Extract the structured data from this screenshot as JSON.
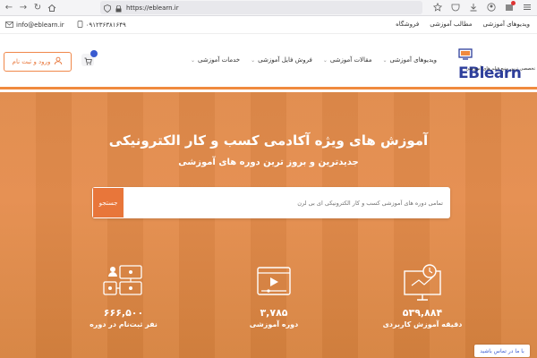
{
  "browser": {
    "url": "https://eblearn.ir",
    "accent": "#e8763a"
  },
  "topbar": {
    "email": "info@eblearn.ir",
    "phone": "۰۹۱۲۳۶۳۸۱۶۴۹",
    "links": [
      "ویدیوهای آموزشی",
      "مطالب آموزشی",
      "فروشگاه"
    ]
  },
  "header": {
    "login_label": "ورود و ثبت نام",
    "logo_text_main": "EBlearn",
    "logo_text_sub": "تخصصی ترین منبع فیلم های آموزشی",
    "menu": [
      "ویدیوهای آموزشی",
      "مقالات آموزشی",
      "فروش فایل آموزشی",
      "خدمات آموزشی"
    ]
  },
  "hero": {
    "title": "آموزش های ویژه آکادمی کسب و کار الکترونیکی",
    "subtitle": "جدیدترین و بروز ترین دوره های آموزشی",
    "search_placeholder": "تمامی دوره های آموزشی کسب و کار الکترونیکی ای بی لرن",
    "search_button": "جستجو"
  },
  "stats": [
    {
      "number": "۵۳۹,۸۸۴",
      "label": "دقیقه آموزش کاربردی",
      "icon": "clock-monitor-icon"
    },
    {
      "number": "۳,۷۸۵",
      "label": "دوره آموزشی",
      "icon": "video-player-icon"
    },
    {
      "number": "۶۶۶,۵۰۰",
      "label": "نفر ثبت‌نام در دوره",
      "icon": "users-network-icon"
    }
  ],
  "contact_chip": "با ما در تماس باشید"
}
